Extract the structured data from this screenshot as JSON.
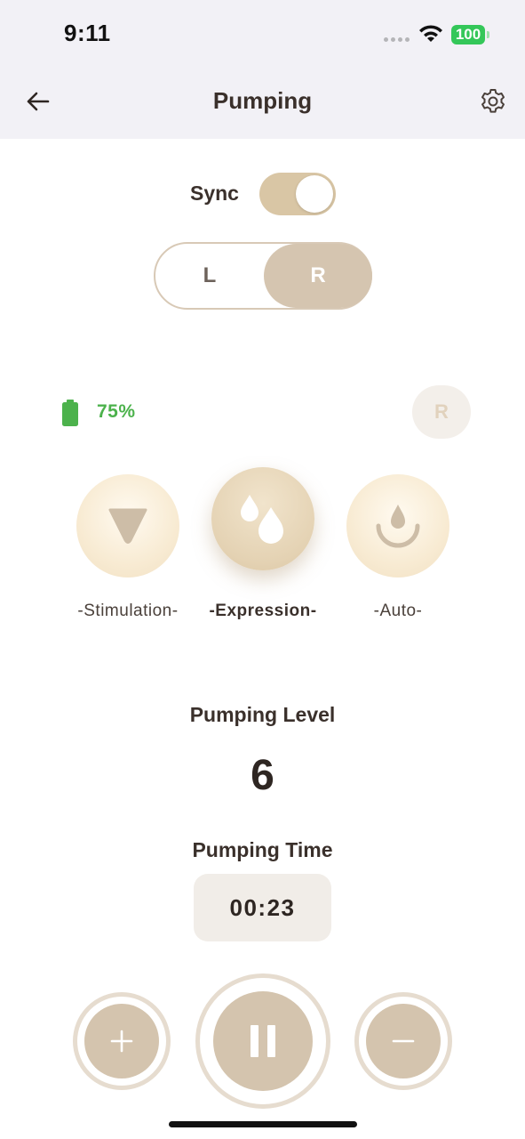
{
  "status_bar": {
    "time": "9:11",
    "battery": "100"
  },
  "header": {
    "title": "Pumping"
  },
  "sync": {
    "label": "Sync",
    "enabled": true
  },
  "side_select": {
    "left": "L",
    "right": "R",
    "selected": "R"
  },
  "device": {
    "battery_percent": "75%",
    "side_badge": "R"
  },
  "modes": [
    {
      "label": "-Stimulation-",
      "icon": "triangle-down-icon",
      "active": false
    },
    {
      "label": "-Expression-",
      "icon": "water-drops-icon",
      "active": true
    },
    {
      "label": "-Auto-",
      "icon": "drop-bowl-icon",
      "active": false
    }
  ],
  "level": {
    "title": "Pumping Level",
    "value": "6"
  },
  "time": {
    "title": "Pumping Time",
    "value": "00:23"
  },
  "colors": {
    "accent": "#d4c4ae",
    "battery_green": "#4cb24c",
    "header_bg": "#f2f1f6"
  }
}
